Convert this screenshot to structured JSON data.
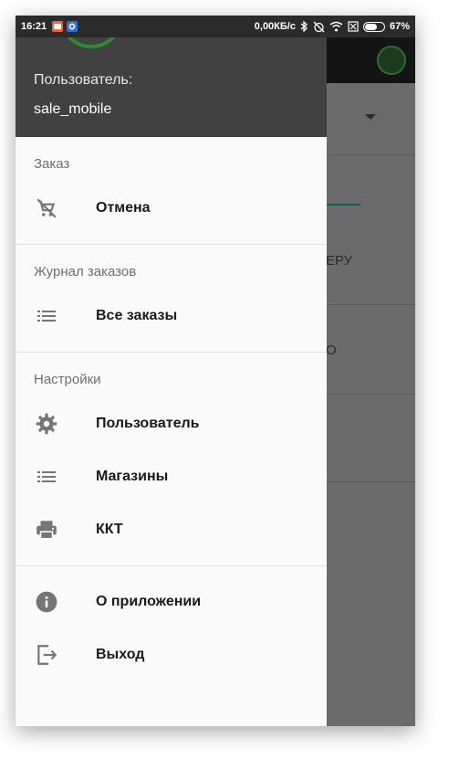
{
  "status_bar": {
    "time": "16:21",
    "network_speed": "0,00КБ/с",
    "battery_percent": "67%",
    "battery_level": 0.67
  },
  "background_app": {
    "partial_text_1": "ЕРУ",
    "partial_text_2": "О"
  },
  "drawer": {
    "header": {
      "user_label": "Пользователь:",
      "user_name": "sale_mobile"
    },
    "sections": {
      "order": {
        "title": "Заказ",
        "items": [
          {
            "label": "Отмена",
            "icon": "cart-off-icon"
          }
        ]
      },
      "journal": {
        "title": "Журнал заказов",
        "items": [
          {
            "label": "Все заказы",
            "icon": "list-icon"
          }
        ]
      },
      "settings": {
        "title": "Настройки",
        "items": [
          {
            "label": "Пользователь",
            "icon": "gear-icon"
          },
          {
            "label": "Магазины",
            "icon": "list-icon"
          },
          {
            "label": "ККТ",
            "icon": "printer-icon"
          }
        ]
      },
      "misc": {
        "items": [
          {
            "label": "О приложении",
            "icon": "info-icon"
          },
          {
            "label": "Выход",
            "icon": "exit-icon"
          }
        ]
      }
    }
  },
  "colors": {
    "drawer_bg": "#fafafa",
    "header_bg": "#414141",
    "icon_gray": "#757575",
    "accent_green": "#2f8a35",
    "scrim": "#6b6b6b"
  }
}
